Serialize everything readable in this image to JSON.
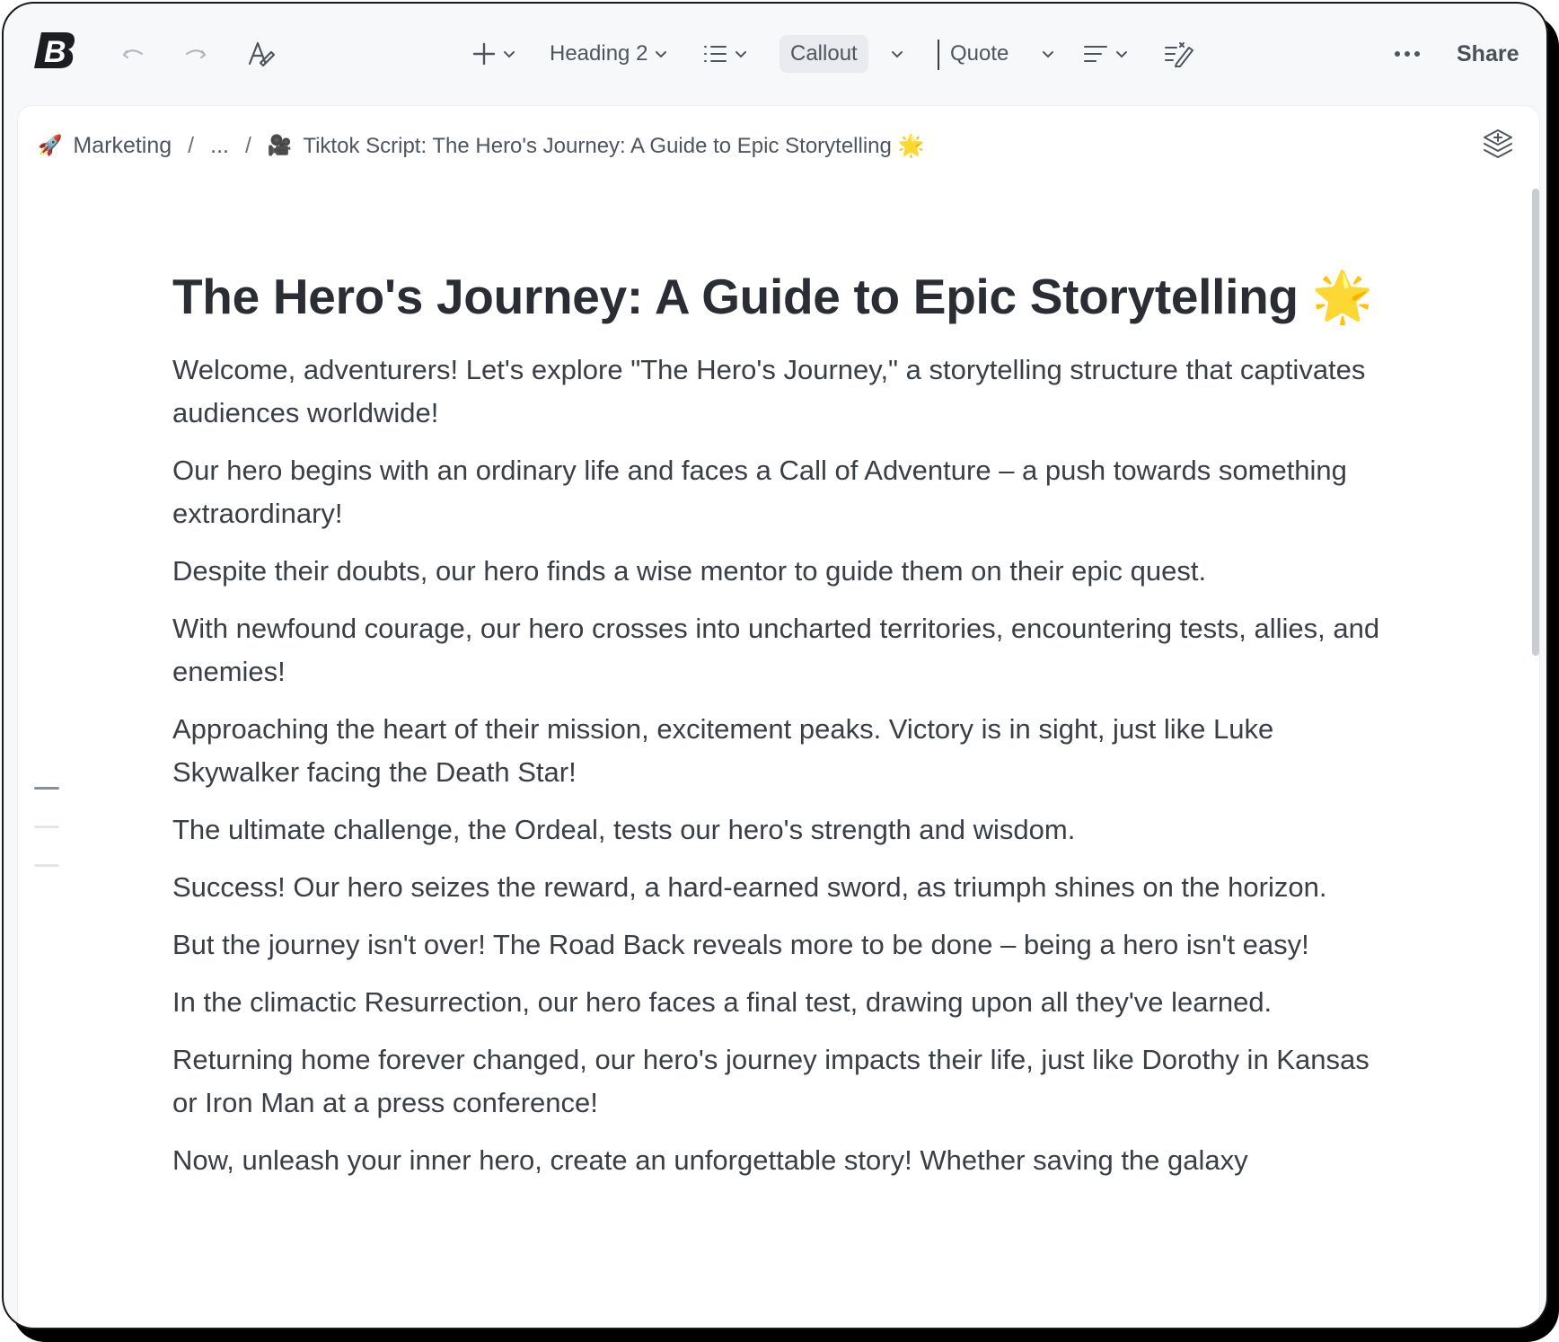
{
  "toolbar": {
    "logo_letter": "B",
    "heading_label": "Heading 2",
    "callout_label": "Callout",
    "quote_label": "Quote",
    "share_label": "Share",
    "icons": [
      "undo-icon",
      "redo-icon",
      "clear-format-icon",
      "plus-icon",
      "list-icon",
      "align-icon",
      "ai-edit-icon",
      "more-icon"
    ]
  },
  "breadcrumb": {
    "root_emoji": "🚀",
    "root_label": "Marketing",
    "separator": "/",
    "ellipsis": "...",
    "page_emoji": "🎥",
    "page_label": "Tiktok Script: The Hero's Journey: A Guide to Epic Storytelling 🌟"
  },
  "document": {
    "title": "The Hero's Journey: A Guide to Epic Storytelling 🌟",
    "paragraphs": [
      "Welcome, adventurers! Let's explore \"The Hero's Journey,\" a storytelling structure that captivates audiences worldwide!",
      "Our hero begins with an ordinary life and faces a Call of Adventure – a push towards something extraordinary!",
      "Despite their doubts, our hero finds a wise mentor to guide them on their epic quest.",
      "With newfound courage, our hero crosses into uncharted territories, encountering tests, allies, and enemies!",
      "Approaching the heart of their mission, excitement peaks. Victory is in sight, just like Luke Skywalker facing the Death Star!",
      "The ultimate challenge, the Ordeal, tests our hero's strength and wisdom.",
      "Success! Our hero seizes the reward, a hard-earned sword, as triumph shines on the horizon.",
      "But the journey isn't over! The Road Back reveals more to be done – being a hero isn't easy!",
      "In the climactic Resurrection, our hero faces a final test, drawing upon all they've learned.",
      "Returning home forever changed, our hero's journey impacts their life, just like Dorothy in Kansas or Iron Man at a press conference!",
      "Now, unleash your inner hero, create an unforgettable story!  Whether saving the galaxy"
    ]
  }
}
